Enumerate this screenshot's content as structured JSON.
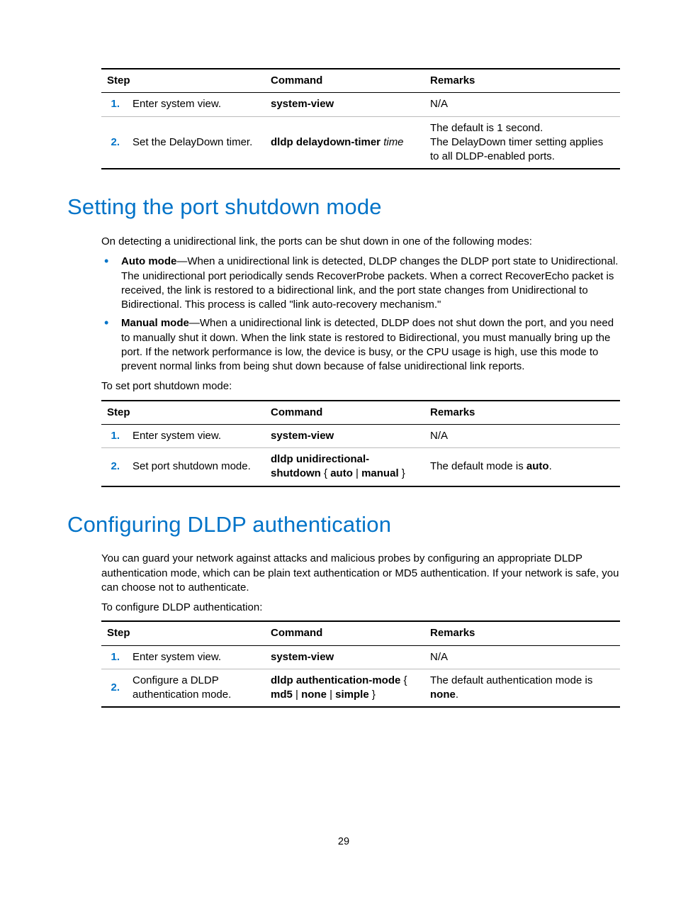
{
  "page_number": "29",
  "headers": {
    "step": "Step",
    "command": "Command",
    "remarks": "Remarks"
  },
  "table1": {
    "rows": [
      {
        "num": "1.",
        "step": "Enter system view.",
        "cmd_html": "<span class='cmd-part-bold'>system-view</span>",
        "remarks_html": "N/A"
      },
      {
        "num": "2.",
        "step": "Set the DelayDown timer.",
        "cmd_html": "<span class='cmd-part-bold'>dldp delaydown-timer</span> <span class='cmd-part-ital'>time</span>",
        "remarks_html": "The default is 1 second.<br>The DelayDown timer setting applies to all DLDP-enabled ports."
      }
    ]
  },
  "section1": {
    "heading": "Setting the port shutdown mode",
    "intro": "On detecting a unidirectional link, the ports can be shut down in one of the following modes:",
    "bullets": [
      {
        "label": "Auto mode",
        "text": "—When a unidirectional link is detected, DLDP changes the DLDP port state to Unidirectional. The unidirectional port periodically sends RecoverProbe packets. When a correct RecoverEcho packet is received, the link is restored to a bidirectional link, and the port state changes from Unidirectional to Bidirectional. This process is called \"link auto-recovery mechanism.\""
      },
      {
        "label": "Manual mode",
        "text": "—When a unidirectional link is detected, DLDP does not shut down the port, and you need to manually shut it down. When the link state is restored to Bidirectional, you must manually bring up the port. If the network performance is low, the device is busy, or the CPU usage is high, use this mode to prevent normal links from being shut down because of false unidirectional link reports."
      }
    ],
    "lead": "To set port shutdown mode:"
  },
  "table2": {
    "rows": [
      {
        "num": "1.",
        "step": "Enter system view.",
        "cmd_html": "<span class='cmd-part-bold'>system-view</span>",
        "remarks_html": "N/A"
      },
      {
        "num": "2.",
        "step": "Set port shutdown mode.",
        "cmd_html": "<span class='cmd-part-bold'>dldp unidirectional-shutdown</span> { <span class='cmd-part-bold'>auto</span> | <span class='cmd-part-bold'>manual</span> }",
        "remarks_html": "The default mode is <span class='bold'>auto</span>."
      }
    ]
  },
  "section2": {
    "heading": "Configuring DLDP authentication",
    "intro": "You can guard your network against attacks and malicious probes by configuring an appropriate DLDP authentication mode, which can be plain text authentication or MD5 authentication. If your network is safe, you can choose not to authenticate.",
    "lead": "To configure DLDP authentication:"
  },
  "table3": {
    "rows": [
      {
        "num": "1.",
        "step": "Enter system view.",
        "cmd_html": "<span class='cmd-part-bold'>system-view</span>",
        "remarks_html": "N/A"
      },
      {
        "num": "2.",
        "step": "Configure a DLDP authentication mode.",
        "cmd_html": "<span class='cmd-part-bold'>dldp authentication-mode</span> { <span class='cmd-part-bold'>md5</span> | <span class='cmd-part-bold'>none</span> | <span class='cmd-part-bold'>simple</span> }",
        "remarks_html": "The default authentication mode is <span class='bold'>none</span>."
      }
    ]
  }
}
